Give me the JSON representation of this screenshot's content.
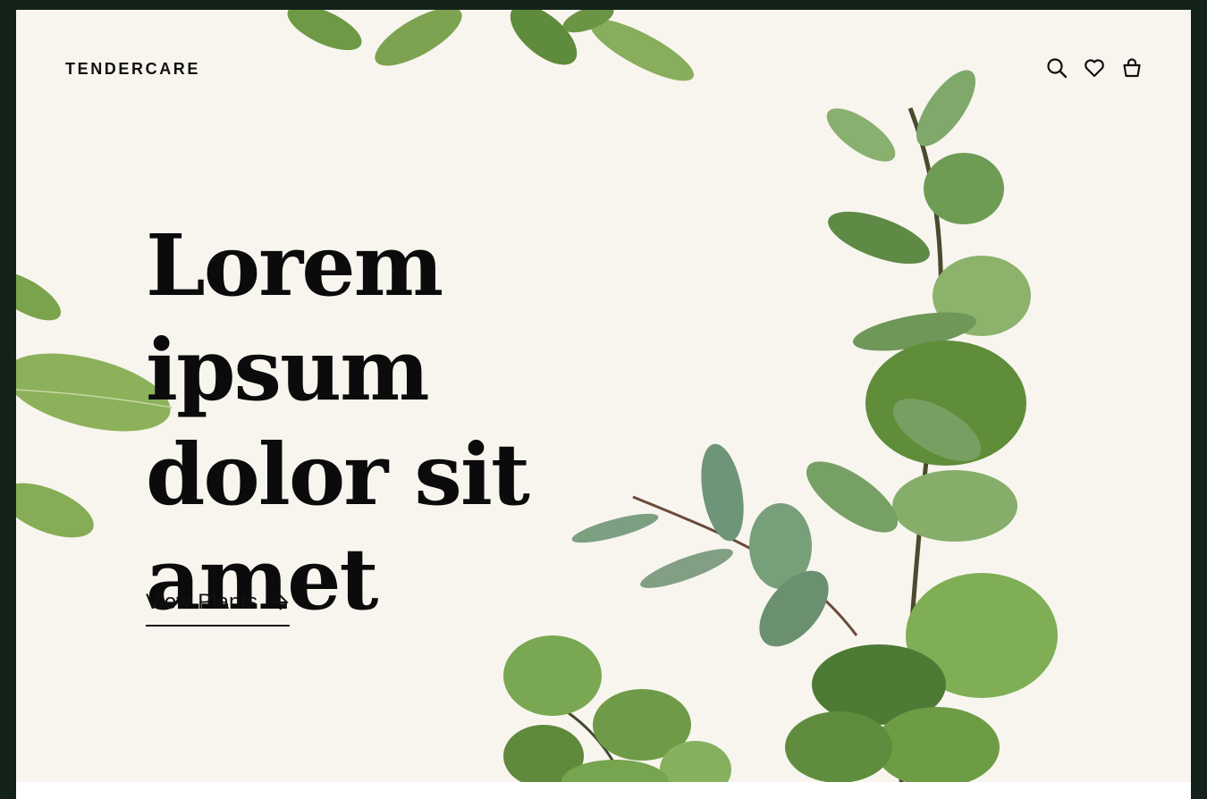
{
  "header": {
    "logo": "TENDERCARE",
    "icons": [
      "search-icon",
      "heart-icon",
      "bag-icon"
    ]
  },
  "hero": {
    "title_lines": [
      "Lorem ipsum",
      "dolor sit",
      "amet"
    ],
    "cta_label": "View Plants"
  },
  "colors": {
    "page_background": "#13231a",
    "panel_background": "#f8f5ef",
    "text": "#0b0b0b",
    "leaf_light": "#8fb36a",
    "leaf_dark": "#4f7a3a",
    "leaf_blue": "#6f9578"
  }
}
